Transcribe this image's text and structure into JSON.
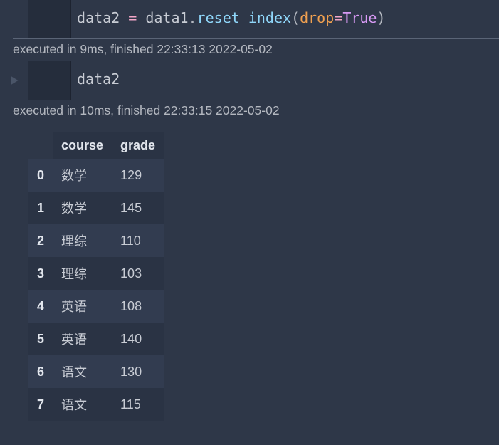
{
  "cells": [
    {
      "code_tokens": [
        {
          "t": "data2 ",
          "cls": "tok-id"
        },
        {
          "t": "=",
          "cls": "tok-op"
        },
        {
          "t": " data1",
          "cls": "tok-id"
        },
        {
          "t": ".",
          "cls": "tok-punc"
        },
        {
          "t": "reset_index",
          "cls": "tok-call"
        },
        {
          "t": "(",
          "cls": "tok-punc"
        },
        {
          "t": "drop",
          "cls": "tok-kwarg"
        },
        {
          "t": "=",
          "cls": "tok-op"
        },
        {
          "t": "True",
          "cls": "tok-const"
        },
        {
          "t": ")",
          "cls": "tok-punc"
        }
      ],
      "exec_status": "executed in 9ms, finished 22:33:13 2022-05-02"
    },
    {
      "code_tokens": [
        {
          "t": "data2",
          "cls": "tok-id"
        }
      ],
      "exec_status": "executed in 10ms, finished 22:33:15 2022-05-02"
    }
  ],
  "chart_data": {
    "type": "table",
    "columns": [
      "course",
      "grade"
    ],
    "index": [
      "0",
      "1",
      "2",
      "3",
      "4",
      "5",
      "6",
      "7"
    ],
    "rows": [
      [
        "数学",
        "129"
      ],
      [
        "数学",
        "145"
      ],
      [
        "理综",
        "110"
      ],
      [
        "理综",
        "103"
      ],
      [
        "英语",
        "108"
      ],
      [
        "英语",
        "140"
      ],
      [
        "语文",
        "130"
      ],
      [
        "语文",
        "115"
      ]
    ]
  }
}
